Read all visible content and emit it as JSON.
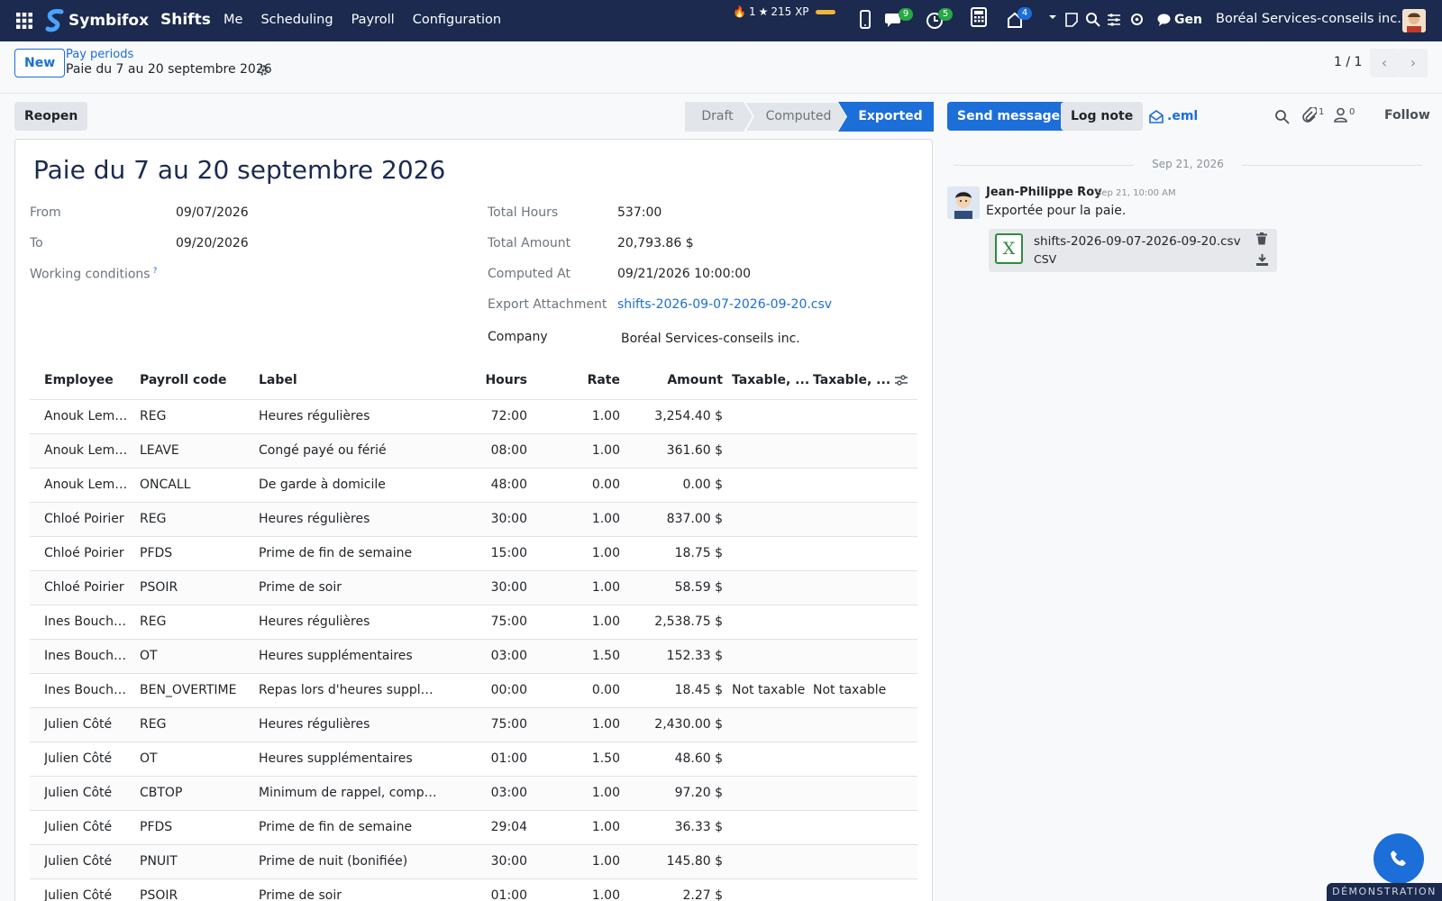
{
  "navbar": {
    "brand": "Symbifox",
    "app_name": "Shifts",
    "menu": [
      "Me",
      "Scheduling",
      "Payroll",
      "Configuration"
    ],
    "streak": "1",
    "xp": "215 XP",
    "badges": {
      "messages": "9",
      "activities": "5",
      "notifications": "4"
    },
    "lang": "Gen",
    "company": "Boréal Services-conseils inc."
  },
  "control": {
    "new_label": "New",
    "breadcrumb_parent": "Pay periods",
    "breadcrumb_current": "Paie du 7 au 20 septembre 2026",
    "pager": "1 / 1"
  },
  "actions": {
    "reopen": "Reopen",
    "stages": [
      "Draft",
      "Computed",
      "Exported"
    ],
    "active_stage": "Exported"
  },
  "chatter_bar": {
    "send_message": "Send message",
    "log_note": "Log note",
    "eml": ".eml",
    "attachments_count": "1",
    "followers_count": "0",
    "follow": "Follow"
  },
  "record": {
    "title": "Paie du 7 au 20 septembre 2026",
    "left_fields": [
      {
        "label": "From",
        "value": "09/07/2026"
      },
      {
        "label": "To",
        "value": "09/20/2026"
      },
      {
        "label": "Working conditions",
        "value": ""
      }
    ],
    "working_conditions_help": "?",
    "right_fields": [
      {
        "label": "Total Hours",
        "value": "537:00"
      },
      {
        "label": "Total Amount",
        "value": "20,793.86 $"
      },
      {
        "label": "Computed At",
        "value": "09/21/2026 10:00:00"
      },
      {
        "label": "Export Attachment",
        "value": "shifts-2026-09-07-2026-09-20.csv"
      },
      {
        "label": "Company",
        "value": "Boréal Services-conseils inc."
      }
    ]
  },
  "table": {
    "headers": [
      "Employee",
      "Payroll code",
      "Label",
      "Hours",
      "Rate",
      "Amount",
      "Taxable, ...",
      "Taxable, ..."
    ],
    "rows": [
      [
        "Anouk Lemieux",
        "REG",
        "Heures régulières",
        "72:00",
        "1.00",
        "3,254.40 $",
        "",
        ""
      ],
      [
        "Anouk Lemieux",
        "LEAVE",
        "Congé payé ou férié",
        "08:00",
        "1.00",
        "361.60 $",
        "",
        ""
      ],
      [
        "Anouk Lemieux",
        "ONCALL",
        "De garde à domicile",
        "48:00",
        "0.00",
        "0.00 $",
        "",
        ""
      ],
      [
        "Chloé Poirier",
        "REG",
        "Heures régulières",
        "30:00",
        "1.00",
        "837.00 $",
        "",
        ""
      ],
      [
        "Chloé Poirier",
        "PFDS",
        "Prime de fin de semaine",
        "15:00",
        "1.00",
        "18.75 $",
        "",
        ""
      ],
      [
        "Chloé Poirier",
        "PSOIR",
        "Prime de soir",
        "30:00",
        "1.00",
        "58.59 $",
        "",
        ""
      ],
      [
        "Ines Bouchard",
        "REG",
        "Heures régulières",
        "75:00",
        "1.00",
        "2,538.75 $",
        "",
        ""
      ],
      [
        "Ines Bouchard",
        "OT",
        "Heures supplémentaires",
        "03:00",
        "1.50",
        "152.33 $",
        "",
        ""
      ],
      [
        "Ines Bouchard",
        "BEN_OVERTIME",
        "Repas lors d'heures supplémentaires",
        "00:00",
        "0.00",
        "18.45 $",
        "Not taxable",
        "Not taxable"
      ],
      [
        "Julien Côté",
        "REG",
        "Heures régulières",
        "75:00",
        "1.00",
        "2,430.00 $",
        "",
        ""
      ],
      [
        "Julien Côté",
        "OT",
        "Heures supplémentaires",
        "01:00",
        "1.50",
        "48.60 $",
        "",
        ""
      ],
      [
        "Julien Côté",
        "CBTOP",
        "Minimum de rappel, complément",
        "03:00",
        "1.00",
        "97.20 $",
        "",
        ""
      ],
      [
        "Julien Côté",
        "PFDS",
        "Prime de fin de semaine",
        "29:04",
        "1.00",
        "36.33 $",
        "",
        ""
      ],
      [
        "Julien Côté",
        "PNUIT",
        "Prime de nuit (bonifiée)",
        "30:00",
        "1.00",
        "145.80 $",
        "",
        ""
      ],
      [
        "Julien Côté",
        "PSOIR",
        "Prime de soir",
        "01:00",
        "1.00",
        "2.27 $",
        "",
        ""
      ]
    ]
  },
  "chatter": {
    "date": "Sep 21, 2026",
    "author": "Jean-Philippe Roy",
    "time": "Sep 21, 10:00 AM",
    "body": "Exportée pour la paie.",
    "attachment_name": "shifts-2026-09-07-2026-09-20.csv",
    "attachment_type": "CSV"
  },
  "footer": {
    "demo": "DÉMONSTRATION"
  },
  "colors": {
    "navbar": "#1b2a4e",
    "primary": "#1c6ed8",
    "badge_green": "#28a745",
    "badge_blue": "#1c6ed8"
  }
}
